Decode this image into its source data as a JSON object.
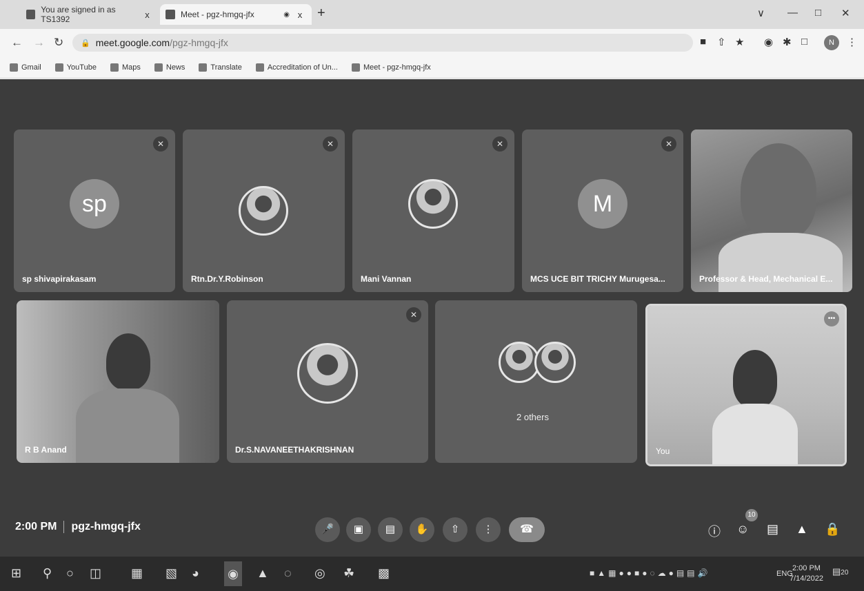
{
  "browser": {
    "tabs": [
      {
        "title": "You are signed in as TS1392",
        "close": "x"
      },
      {
        "title": "Meet - pgz-hmgq-jfx",
        "close": "x"
      }
    ],
    "new_tab": "+",
    "window_controls": {
      "chevron": "∨",
      "minimize": "—",
      "restore": "□",
      "close": "✕"
    },
    "url_host": "meet.google.com",
    "url_path": "/pgz-hmgq-jfx",
    "profile_initial": "N",
    "bookmarks": [
      "Gmail",
      "YouTube",
      "Maps",
      "News",
      "Translate",
      "Accreditation of Un...",
      "Meet - pgz-hmgq-jfx"
    ]
  },
  "meet": {
    "tiles_row1": [
      {
        "name": "sp shivapirakasam",
        "initials": "sp"
      },
      {
        "name": "Rtn.Dr.Y.Robinson"
      },
      {
        "name": "Mani Vannan"
      },
      {
        "name": "MCS UCE BIT TRICHY Murugesa...",
        "initials": "M"
      },
      {
        "name": "Professor & Head, Mechanical E..."
      }
    ],
    "tiles_row2": [
      {
        "name": "R B Anand"
      },
      {
        "name": "Dr.S.NAVANEETHAKRISHNAN"
      },
      {
        "label": "2 others"
      },
      {
        "name": "You",
        "more": "•••"
      }
    ],
    "time": "2:00 PM",
    "meeting_code": "pgz-hmgq-jfx",
    "participants_count": "10"
  },
  "taskbar": {
    "language": "ENG",
    "time": "2:00 PM",
    "date": "7/14/2022",
    "notifications": "20"
  }
}
